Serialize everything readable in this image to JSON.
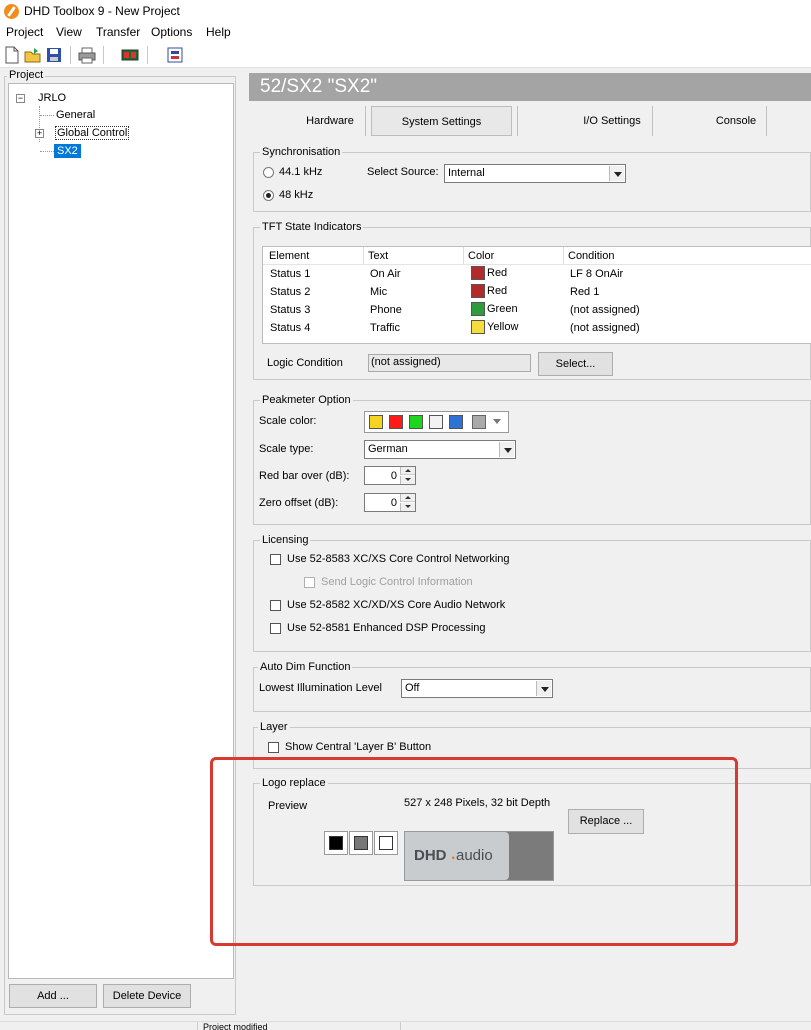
{
  "window": {
    "title": "DHD Toolbox 9 - New Project"
  },
  "menu": [
    "Project",
    "View",
    "Transfer",
    "Options",
    "Help"
  ],
  "toolbar": {
    "icons": [
      "new-file-icon",
      "open-folder-icon",
      "save-icon",
      "print-icon",
      "device-icon",
      "config-icon"
    ]
  },
  "left_panel": {
    "title": "Project",
    "tree": {
      "root": "JRLO",
      "items": [
        "General",
        "Global Control",
        "SX2"
      ],
      "selected": "SX2"
    },
    "buttons": {
      "add": "Add ...",
      "delete": "Delete Device"
    }
  },
  "device": {
    "header": "52/SX2 \"SX2\"",
    "tabs": [
      "Hardware",
      "System Settings",
      "I/O Settings",
      "Console"
    ],
    "active_tab": "System Settings"
  },
  "sync": {
    "title": "Synchronisation",
    "options": [
      "44.1 kHz",
      "48 kHz"
    ],
    "selected": "48 kHz",
    "source_label": "Select Source:",
    "source_value": "Internal"
  },
  "tft": {
    "title": "TFT State Indicators",
    "columns": [
      "Element",
      "Text",
      "Color",
      "Condition"
    ],
    "rows": [
      {
        "element": "Status 1",
        "text": "On Air",
        "color": "Red",
        "color_hex": "#b22a2a",
        "condition": "LF 8 OnAir"
      },
      {
        "element": "Status 2",
        "text": "Mic",
        "color": "Red",
        "color_hex": "#b22a2a",
        "condition": "Red 1"
      },
      {
        "element": "Status 3",
        "text": "Phone",
        "color": "Green",
        "color_hex": "#2f9c3b",
        "condition": "(not assigned)"
      },
      {
        "element": "Status 4",
        "text": "Traffic",
        "color": "Yellow",
        "color_hex": "#f4dd3c",
        "condition": "(not assigned)"
      }
    ],
    "logic_label": "Logic Condition",
    "logic_value": "(not assigned)",
    "select_button": "Select..."
  },
  "peakmeter": {
    "title": "Peakmeter Option",
    "scale_color_label": "Scale color:",
    "scale_colors": [
      "#f6d321",
      "#ff1a1a",
      "#1ed51e",
      "#f2f2f2",
      "#2f72d6"
    ],
    "scale_type_label": "Scale type:",
    "scale_type_value": "German",
    "red_bar_label": "Red bar over (dB):",
    "red_bar_value": "0",
    "zero_offset_label": "Zero offset (dB):",
    "zero_offset_value": "0"
  },
  "licensing": {
    "title": "Licensing",
    "items": [
      "Use 52-8583 XC/XS Core Control Networking",
      "Send Logic Control Information",
      "Use 52-8582 XC/XD/XS Core Audio Network",
      "Use 52-8581 Enhanced DSP Processing"
    ]
  },
  "autodim": {
    "title": "Auto Dim Function",
    "label": "Lowest Illumination Level",
    "value": "Off"
  },
  "layer": {
    "title": "Layer",
    "checkbox": "Show Central 'Layer B' Button"
  },
  "logo": {
    "title": "Logo replace",
    "preview_label": "Preview",
    "info": "527 x 248 Pixels, 32 bit Depth",
    "replace_button": "Replace ...",
    "bg_colors": [
      "#000000",
      "#777777",
      "#ffffff"
    ],
    "logo_text_main": "DHD",
    "logo_text_dot": ".",
    "logo_text_suffix": "audio"
  },
  "statusbar": {
    "text": "Project modified"
  }
}
